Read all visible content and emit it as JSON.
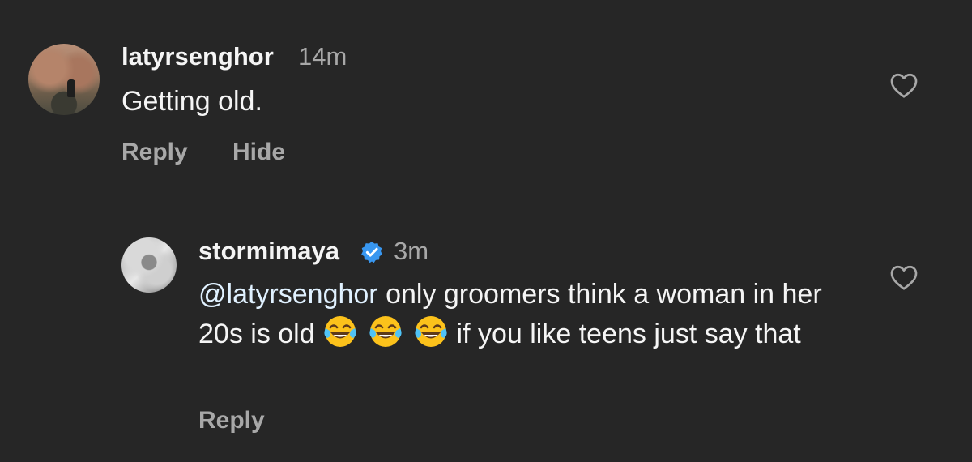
{
  "comments": [
    {
      "username": "latyrsenghor",
      "time": "14m",
      "text": "Getting old.",
      "actions": {
        "reply": "Reply",
        "hide": "Hide"
      },
      "like_icon": "heart-icon"
    },
    {
      "username": "stormimaya",
      "verified": true,
      "time": "3m",
      "mention": "@latyrsenghor",
      "text_part1": " only groomers think a woman in her 20s is old ",
      "emoji": "😂",
      "emoji_count": 3,
      "text_part2": " if you like teens just say that",
      "actions": {
        "reply": "Reply"
      },
      "like_icon": "heart-icon"
    }
  ],
  "colors": {
    "background": "#262626",
    "primary_text": "#f5f5f5",
    "secondary_text": "#a8a8a8",
    "mention": "#e0f1ff",
    "verified_badge": "#3897f0"
  }
}
